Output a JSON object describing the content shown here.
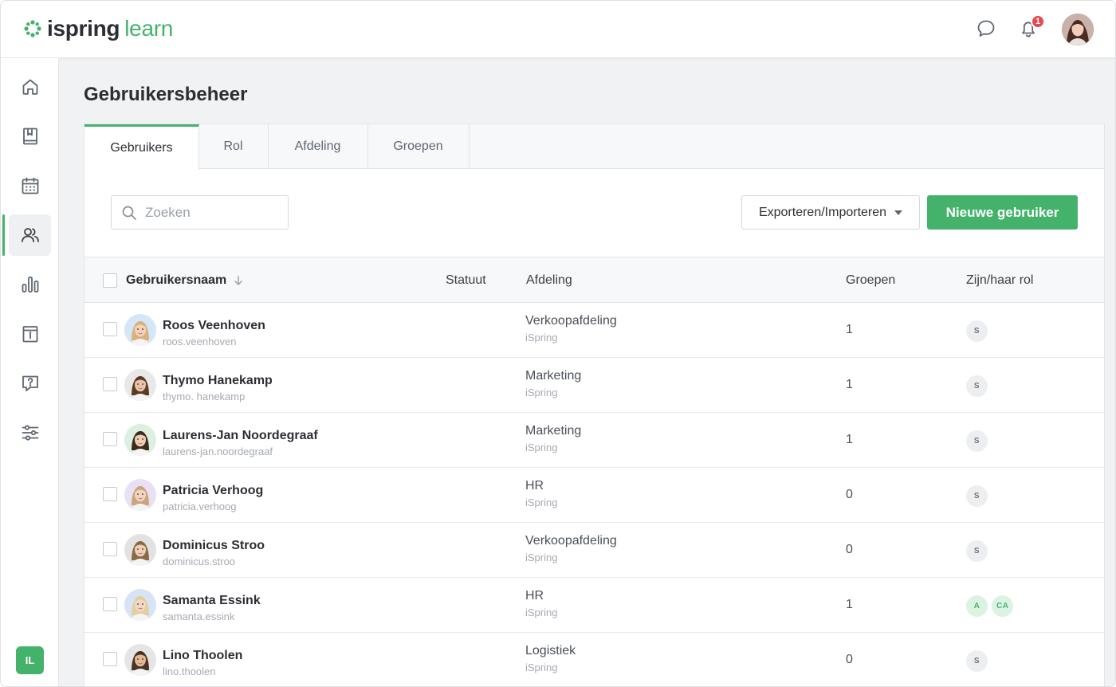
{
  "app": {
    "logo_part1": "ispring",
    "logo_part2": "learn",
    "notification_count": "1",
    "user_initials": "IL",
    "accent_color": "#45b26b"
  },
  "sidebar": {
    "items": [
      {
        "name": "home-icon"
      },
      {
        "name": "book-icon"
      },
      {
        "name": "calendar-icon"
      },
      {
        "name": "users-icon",
        "active": true
      },
      {
        "name": "bar-chart-icon"
      },
      {
        "name": "info-calendar-icon"
      },
      {
        "name": "question-icon"
      },
      {
        "name": "settings-sliders-icon"
      }
    ]
  },
  "page": {
    "title": "Gebruikersbeheer"
  },
  "tabs": [
    {
      "label": "Gebruikers",
      "active": true
    },
    {
      "label": "Rol"
    },
    {
      "label": "Afdeling"
    },
    {
      "label": "Groepen"
    }
  ],
  "toolbar": {
    "search_placeholder": "Zoeken",
    "export_label": "Exporteren/Importeren",
    "new_user_label": "Nieuwe gebruiker"
  },
  "table": {
    "columns": [
      "Gebruikersnaam",
      "Statuut",
      "Afdeling",
      "Groepen",
      "Zijn/haar rol"
    ],
    "rows": [
      {
        "name": "Roos Veenhoven",
        "login": "roos.veenhoven",
        "dept": "Verkoopafdeling",
        "org": "iSpring",
        "groups": "1",
        "roles": [
          "S"
        ],
        "avatar_bg": "#d4e6f7",
        "hair": "#d8b27a",
        "skin": "#f2d2bd"
      },
      {
        "name": "Thymo Hanekamp",
        "login": "thymo. hanekamp",
        "dept": "Marketing",
        "org": "iSpring",
        "groups": "1",
        "roles": [
          "S"
        ],
        "avatar_bg": "#e8e8e8",
        "hair": "#5a3a24",
        "skin": "#e9c4a8"
      },
      {
        "name": "Laurens-Jan Noordegraaf",
        "login": "laurens-jan.noordegraaf",
        "dept": "Marketing",
        "org": "iSpring",
        "groups": "1",
        "roles": [
          "S"
        ],
        "avatar_bg": "#dcefe1",
        "hair": "#3d2a1c",
        "skin": "#edcdb5"
      },
      {
        "name": "Patricia Verhoog",
        "login": "patricia.verhoog",
        "dept": "HR",
        "org": "iSpring",
        "groups": "0",
        "roles": [
          "S"
        ],
        "avatar_bg": "#e9e0f3",
        "hair": "#c9a57a",
        "skin": "#f1d4c2"
      },
      {
        "name": "Dominicus Stroo",
        "login": "dominicus.stroo",
        "dept": "Verkoopafdeling",
        "org": "iSpring",
        "groups": "0",
        "roles": [
          "S"
        ],
        "avatar_bg": "#e2e2e2",
        "hair": "#8a6a44",
        "skin": "#edd0b8"
      },
      {
        "name": "Samanta Essink",
        "login": "samanta.essink",
        "dept": "HR",
        "org": "iSpring",
        "groups": "1",
        "roles": [
          "A",
          "CA"
        ],
        "avatar_bg": "#d6e4f6",
        "hair": "#e2cf9e",
        "skin": "#f3d8c6"
      },
      {
        "name": "Lino Thoolen",
        "login": "lino.thoolen",
        "dept": "Logistiek",
        "org": "iSpring",
        "groups": "0",
        "roles": [
          "S"
        ],
        "avatar_bg": "#e5e5e5",
        "hair": "#4a3224",
        "skin": "#e3b895"
      }
    ]
  }
}
